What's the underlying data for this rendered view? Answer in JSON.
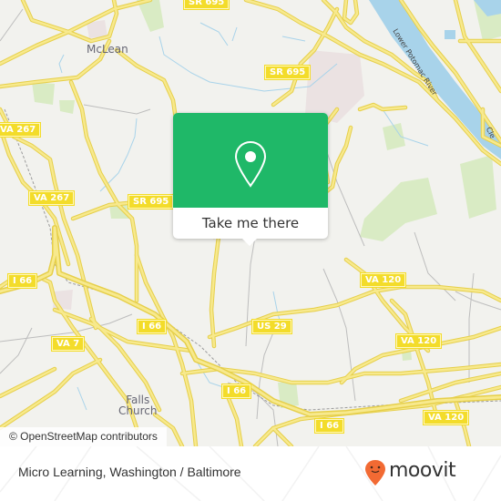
{
  "map": {
    "place_labels": [
      {
        "id": "mclean",
        "text": "McLean"
      },
      {
        "id": "falls-church",
        "text": "Falls\nChurch"
      }
    ],
    "river_labels": [
      {
        "id": "lower-potomac",
        "text": "Lower Potomac River"
      },
      {
        "id": "clara-partial",
        "text": "Cle"
      }
    ],
    "road_shields": [
      {
        "id": "sr695-top",
        "text": "SR 695"
      },
      {
        "id": "va267-left",
        "text": "VA 267"
      },
      {
        "id": "va267-mid",
        "text": "VA 267"
      },
      {
        "id": "sr695-mid",
        "text": "SR 695"
      },
      {
        "id": "i66-left",
        "text": "I 66"
      },
      {
        "id": "va120-1",
        "text": "VA 120"
      },
      {
        "id": "us29",
        "text": "US 29"
      },
      {
        "id": "i66-center",
        "text": "I 66"
      },
      {
        "id": "va120-2",
        "text": "VA 120"
      },
      {
        "id": "va7",
        "text": "VA 7"
      },
      {
        "id": "i66-lower",
        "text": "I 66"
      },
      {
        "id": "i66-bottom",
        "text": "I 66"
      },
      {
        "id": "va120-3",
        "text": "VA 120"
      }
    ],
    "attribution": "© OpenStreetMap contributors",
    "colors": {
      "road": "#f5e36a",
      "water": "#a8d3ea",
      "park": "#d6eac0",
      "land": "#f2f2ee"
    }
  },
  "popup": {
    "pin_icon": "map-pin-icon",
    "button_label": "Take me there",
    "accent": "#1fb868"
  },
  "footer": {
    "title": "Micro Learning, Washington / Baltimore",
    "brand": "moovit",
    "brand_color": "#f26a33"
  }
}
